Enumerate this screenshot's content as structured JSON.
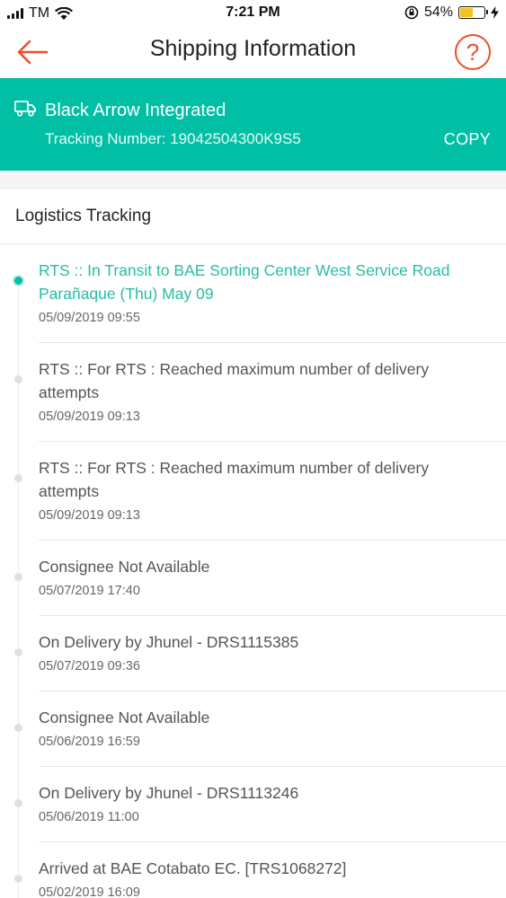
{
  "status_bar": {
    "carrier": "TM",
    "time": "7:21 PM",
    "battery_percent": "54%",
    "battery_level": 0.54
  },
  "nav": {
    "title": "Shipping Information",
    "help_label": "?"
  },
  "carrier": {
    "name": "Black Arrow Integrated",
    "tracking_label": "Tracking Number: 19042504300K9S5",
    "copy_label": "COPY",
    "accent_color": "#00bfa5"
  },
  "logistics": {
    "title": "Logistics Tracking",
    "events": [
      {
        "text": "RTS :: In Transit to BAE Sorting Center West Service Road Parañaque (Thu) May 09",
        "time": "05/09/2019 09:55",
        "active": true
      },
      {
        "text": "RTS :: For RTS : Reached maximum number of delivery attempts",
        "time": "05/09/2019 09:13",
        "active": false
      },
      {
        "text": "RTS :: For RTS : Reached maximum number of delivery attempts",
        "time": "05/09/2019 09:13",
        "active": false
      },
      {
        "text": "Consignee Not Available",
        "time": "05/07/2019 17:40",
        "active": false
      },
      {
        "text": "On Delivery by Jhunel - DRS1115385",
        "time": "05/07/2019 09:36",
        "active": false
      },
      {
        "text": "Consignee Not Available",
        "time": "05/06/2019 16:59",
        "active": false
      },
      {
        "text": "On Delivery by Jhunel - DRS1113246",
        "time": "05/06/2019 11:00",
        "active": false
      },
      {
        "text": "Arrived at BAE Cotabato EC. [TRS1068272]",
        "time": "05/02/2019 16:09",
        "active": false
      }
    ]
  }
}
